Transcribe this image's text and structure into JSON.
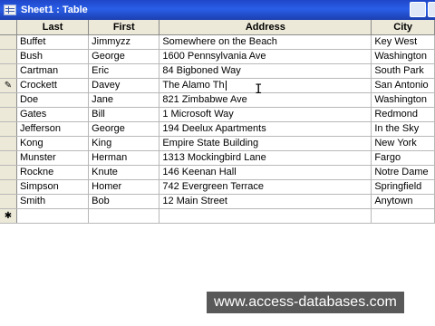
{
  "window": {
    "title": "Sheet1 : Table",
    "icon": "table-icon"
  },
  "table": {
    "columns": [
      "Last",
      "First",
      "Address",
      "City"
    ],
    "rows": [
      [
        "Buffet",
        "Jimmyzz",
        "Somewhere on the Beach",
        "Key West"
      ],
      [
        "Bush",
        "George",
        "1600 Pennsylvania Ave",
        "Washington"
      ],
      [
        "Cartman",
        "Eric",
        "84 Bigboned Way",
        "South Park"
      ],
      [
        "Crockett",
        "Davey",
        "The Alamo Th",
        "San Antonio"
      ],
      [
        "Doe",
        "Jane",
        "821 Zimbabwe Ave",
        "Washington"
      ],
      [
        "Gates",
        "Bill",
        "1 Microsoft Way",
        "Redmond"
      ],
      [
        "Jefferson",
        "George",
        "194 Deelux Apartments",
        "In the Sky"
      ],
      [
        "Kong",
        "King",
        "Empire State Building",
        "New York"
      ],
      [
        "Munster",
        "Herman",
        "1313 Mockingbird Lane",
        "Fargo"
      ],
      [
        "Rockne",
        "Knute",
        "146 Keenan Hall",
        "Notre Dame"
      ],
      [
        "Simpson",
        "Homer",
        "742 Evergreen Terrace",
        "Springfield"
      ],
      [
        "Smith",
        "Bob",
        "12 Main Street",
        "Anytown"
      ]
    ],
    "editing_row": 3,
    "edit_icon": "pencil-icon",
    "new_record_marker": "✱"
  },
  "watermark": "www.access-databases.com"
}
